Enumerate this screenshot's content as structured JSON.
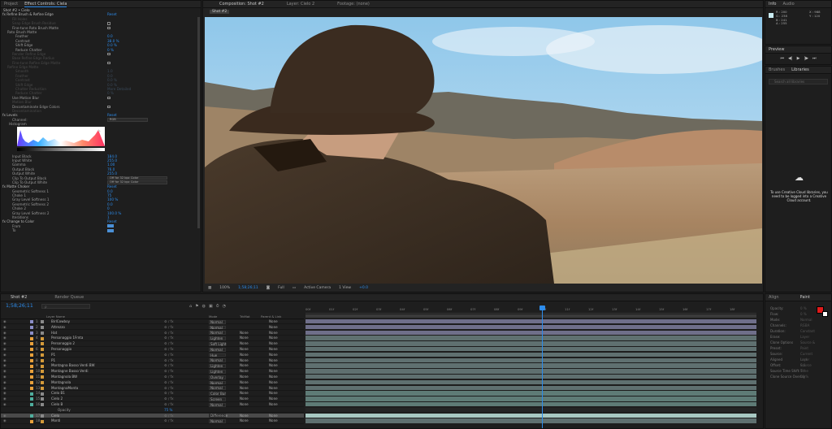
{
  "top_tabs": {
    "project": "Project",
    "effect_controls": "Effect Controls: Ciela",
    "composition": "Composition: Shot #2",
    "layer": "Layer: Cielo 2",
    "footage": "Footage: (none)",
    "info": "Info",
    "audio": "Audio"
  },
  "effect_controls": {
    "breadcrumb": "Shot #2 • Cielo",
    "rows": [
      {
        "label": "fx  Refine Brush & Refine Edge",
        "value": "Reset",
        "indent": 2,
        "kind": "fx"
      },
      {
        "label": "Fill Holes",
        "value": "",
        "indent": 14,
        "kind": "dim"
      },
      {
        "label": "Snap Edge Brush Residue",
        "value": "",
        "indent": 14,
        "kind": "dimcb"
      },
      {
        "label": "Fine-tune Roto Brush Matte",
        "value": "",
        "indent": 14,
        "kind": "cb"
      },
      {
        "label": "Roto Brush Matte",
        "value": "",
        "indent": 8,
        "kind": "text"
      },
      {
        "label": "Feather",
        "value": "0.0",
        "indent": 18,
        "kind": "text"
      },
      {
        "label": "Contrast",
        "value": "38.0 %",
        "indent": 18,
        "kind": "text"
      },
      {
        "label": "Shift Edge",
        "value": "0.0 %",
        "indent": 18,
        "kind": "text"
      },
      {
        "label": "Reduce Chatter",
        "value": "0 %",
        "indent": 18,
        "kind": "text"
      },
      {
        "label": "Render Refine Edge",
        "value": "",
        "indent": 14,
        "kind": "dimcb"
      },
      {
        "label": "Base Refine Edge Radius",
        "value": "",
        "indent": 14,
        "kind": "dim"
      },
      {
        "label": "Fine-tune Refine Edge Matte",
        "value": "",
        "indent": 14,
        "kind": "dimcb"
      },
      {
        "label": "Refine Edge Matte",
        "value": "",
        "indent": 8,
        "kind": "dim"
      },
      {
        "label": "Smooth",
        "value": "1.0",
        "indent": 18,
        "kind": "dim"
      },
      {
        "label": "Feather",
        "value": "0.0",
        "indent": 18,
        "kind": "dim"
      },
      {
        "label": "Contrast",
        "value": "0.0 %",
        "indent": 18,
        "kind": "dim"
      },
      {
        "label": "Shift Edge",
        "value": "0.0 %",
        "indent": 18,
        "kind": "dim"
      },
      {
        "label": "Chatter Reduction",
        "value": "More Detailed",
        "indent": 18,
        "kind": "dim"
      },
      {
        "label": "Reduce Chatter",
        "value": "0 %",
        "indent": 18,
        "kind": "dim"
      },
      {
        "label": "Use Motion Blur",
        "value": "",
        "indent": 14,
        "kind": "cb"
      },
      {
        "label": "Motion Blur",
        "value": "",
        "indent": 14,
        "kind": "dim"
      },
      {
        "label": "Decontaminate Edge Colors",
        "value": "",
        "indent": 14,
        "kind": "cb"
      },
      {
        "label": "Decontamination",
        "value": "",
        "indent": 14,
        "kind": "dim"
      },
      {
        "label": "fx  Levels",
        "value": "Reset",
        "indent": 2,
        "kind": "fx"
      },
      {
        "label": "Channel:",
        "value": "RGB",
        "indent": 14,
        "kind": "dd"
      },
      {
        "label": "Histogram",
        "value": "",
        "indent": 10,
        "kind": "text"
      }
    ],
    "levels_rows": [
      {
        "label": "Input Black",
        "value": "184.0"
      },
      {
        "label": "Input White",
        "value": "255.0"
      },
      {
        "label": "Gamma",
        "value": "1.00"
      },
      {
        "label": "Output Black",
        "value": "76.0"
      },
      {
        "label": "Output White",
        "value": "255.0"
      },
      {
        "label": "Clip To Output Black",
        "value": "Off for 32 bpc Color",
        "kind": "dd"
      },
      {
        "label": "Clip To Output White",
        "value": "Off for 32 bpc Color",
        "kind": "dd"
      }
    ],
    "matte_rows": [
      {
        "label": "fx  Matte Choker",
        "value": "Reset",
        "kind": "fx"
      },
      {
        "label": "Geometric Softness 1",
        "value": "0.0"
      },
      {
        "label": "Choke 1",
        "value": "75"
      },
      {
        "label": "Gray Level Softness 1",
        "value": "100 %"
      },
      {
        "label": "Geometric Softness 2",
        "value": "0.0"
      },
      {
        "label": "Choke 2",
        "value": "0"
      },
      {
        "label": "Gray Level Softness 2",
        "value": "100.0 %"
      },
      {
        "label": "Iterations",
        "value": "1"
      },
      {
        "label": "fx  Change to Color",
        "value": "Reset",
        "kind": "fx"
      },
      {
        "label": "From",
        "value": "",
        "kind": "swatch"
      },
      {
        "label": "To",
        "value": "",
        "kind": "swatch"
      }
    ]
  },
  "composition": {
    "crumb": "Shot #2",
    "zoom": "100%",
    "timecode": "1;58;26;11",
    "resolution": "Full",
    "camera": "Active Camera",
    "views": "1 View",
    "exposure": "+0.0"
  },
  "info": {
    "r": "R : 200",
    "g": "G : 238",
    "b": "B : 241",
    "a": "A : 255",
    "x": "X : 988",
    "y": "Y : 120"
  },
  "preview": {
    "title": "Preview",
    "buttons": [
      "⏮",
      "◀|",
      "▶",
      "|▶",
      "⏭"
    ]
  },
  "libraries": {
    "tabs": [
      "Brushes",
      "Libraries"
    ],
    "search_placeholder": "Search all libraries",
    "message": "To use Creative Cloud libraries, you need to be logged into a Creative Cloud account."
  },
  "timeline": {
    "tabs": [
      "Shot #2",
      "Render Queue"
    ],
    "timecode": "1;58;26;11",
    "search_placeholder": "ρ",
    "headers": {
      "source": "Layer Name",
      "mode": "Mode",
      "t": "T",
      "trkmat": "TrkMat",
      "parent": "Parent & Link"
    },
    "ruler": [
      "00f",
      "01f",
      "02f",
      "03f",
      "04f",
      "05f",
      "06f",
      "07f",
      "08f",
      "09f",
      "10f",
      "11f",
      "12f",
      "13f",
      "14f",
      "15f",
      "16f",
      "17f",
      "18f"
    ],
    "layers": [
      {
        "n": "1",
        "name": "BirlCowboy",
        "mode": "Normal",
        "trk": "",
        "par": "None",
        "c": "#8b8ec8"
      },
      {
        "n": "2",
        "name": "Attrezzo",
        "mode": "Normal",
        "trk": "",
        "par": "None",
        "c": "#8b8ec8"
      },
      {
        "n": "3",
        "name": "Hat",
        "mode": "Normal",
        "trk": "None",
        "par": "None",
        "c": "#8b8ec8"
      },
      {
        "n": "4",
        "name": "Personaggio 1Frnta",
        "mode": "Lighten",
        "trk": "None",
        "par": "None",
        "c": "#e9a13b"
      },
      {
        "n": "5",
        "name": "Personaggio 2",
        "mode": "Soft Light",
        "trk": "None",
        "par": "None",
        "c": "#e9a13b"
      },
      {
        "n": "6",
        "name": "Personaggio",
        "mode": "Normal",
        "trk": "None",
        "par": "None",
        "c": "#e9a13b"
      },
      {
        "n": "7",
        "name": "P1",
        "mode": "Hue",
        "trk": "None",
        "par": "None",
        "c": "#e9a13b"
      },
      {
        "n": "8",
        "name": "P1",
        "mode": "Normal",
        "trk": "None",
        "par": "None",
        "c": "#e9a13b"
      },
      {
        "n": "9",
        "name": "Montagna Basso Verdi BW",
        "mode": "Lighten",
        "trk": "None",
        "par": "None",
        "c": "#e9a13b"
      },
      {
        "n": "10",
        "name": "Montagne Basso Verdi",
        "mode": "Lighten",
        "trk": "None",
        "par": "None",
        "c": "#e9a13b"
      },
      {
        "n": "11",
        "name": "Montagnola BW",
        "mode": "Overlay",
        "trk": "None",
        "par": "None",
        "c": "#e9a13b"
      },
      {
        "n": "12",
        "name": "Montagnola",
        "mode": "Normal",
        "trk": "None",
        "par": "None",
        "c": "#e9a13b"
      },
      {
        "n": "13",
        "name": "MontagnaMonta",
        "mode": "Normal",
        "trk": "None",
        "par": "None",
        "c": "#e9a13b"
      },
      {
        "n": "14",
        "name": "Cielo B1",
        "mode": "Color Bur",
        "trk": "None",
        "par": "None",
        "c": "#4fae9e"
      },
      {
        "n": "15",
        "name": "Cielo 2",
        "mode": "Screen",
        "trk": "None",
        "par": "None",
        "c": "#4fae9e"
      },
      {
        "n": "16",
        "name": "Cielo B",
        "mode": "Normal",
        "trk": "None",
        "par": "None",
        "c": "#4fae9e"
      },
      {
        "n": "",
        "name": "Opacity",
        "mode": "",
        "trk": "",
        "par": "",
        "c": "",
        "opacity": "75 %"
      },
      {
        "n": "17",
        "name": "Cielo",
        "mode": "Difference",
        "trk": "None",
        "par": "None",
        "c": "#4fae9e",
        "selected": true
      },
      {
        "n": "18",
        "name": "Monti",
        "mode": "Normal",
        "trk": "None",
        "par": "None",
        "c": "#e9a13b"
      }
    ]
  },
  "properties": {
    "tabs": [
      "Align",
      "Paint"
    ],
    "rows": [
      {
        "label": "Opacity:",
        "value": "0 %"
      },
      {
        "label": "Flow:",
        "value": "0 %"
      },
      {
        "label": "Mode:",
        "value": "Normal"
      },
      {
        "label": "Channels:",
        "value": "RGBA"
      },
      {
        "label": "Duration:",
        "value": "Constant"
      },
      {
        "label": "Erase:",
        "value": "Layer Source & Paint"
      },
      {
        "label": "Clone Options",
        "value": ""
      },
      {
        "label": "Preset:",
        "value": ""
      },
      {
        "label": "Source:",
        "value": "Current Layer"
      },
      {
        "label": "Aligned",
        "value": "Lock Source Time"
      },
      {
        "label": "Offset:",
        "value": "0,0"
      },
      {
        "label": "Source Time Shift:",
        "value": "0 f"
      },
      {
        "label": "Clone Source Overlay",
        "value": "50 %"
      }
    ]
  },
  "colors": {
    "accent": "#2d8ceb",
    "fg_swatch": "#e01a1a",
    "bg_swatch": "#ffffff"
  }
}
